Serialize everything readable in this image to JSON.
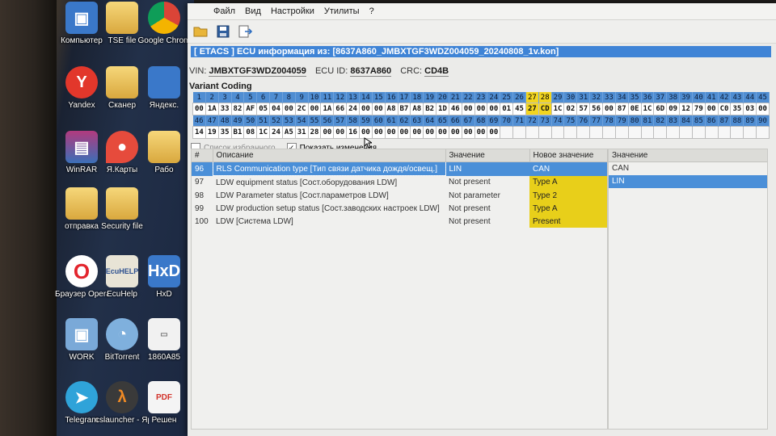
{
  "desktop": {
    "icons": [
      {
        "label": "Компьютер",
        "glyph": "▣",
        "cls": "g-comp",
        "name": "computer-icon"
      },
      {
        "label": "TSE file",
        "glyph": "",
        "cls": "folder",
        "name": "folder-icon"
      },
      {
        "label": "Google Chrom",
        "glyph": "",
        "cls": "g-chrome",
        "name": "chrome-icon"
      },
      {
        "label": "Yandex",
        "glyph": "Y",
        "cls": "g-yandex",
        "name": "yandex-icon"
      },
      {
        "label": "Сканер",
        "glyph": "",
        "cls": "folder",
        "name": "folder-icon"
      },
      {
        "label": "Яндекс.",
        "glyph": "",
        "cls": "g-comp",
        "name": "yandex-disk-icon"
      },
      {
        "label": "WinRAR",
        "glyph": "▤",
        "cls": "g-winrar",
        "name": "winrar-icon"
      },
      {
        "label": "Я.Карты",
        "glyph": "●",
        "cls": "g-maps",
        "name": "yandex-maps-icon"
      },
      {
        "label": "Рабо",
        "glyph": "",
        "cls": "folder",
        "name": "folder-icon"
      },
      {
        "label": "отправка",
        "glyph": "",
        "cls": "folder",
        "name": "folder-icon"
      },
      {
        "label": "Security file",
        "glyph": "",
        "cls": "folder",
        "name": "folder-icon"
      },
      {
        "label": "Браузер Opera",
        "glyph": "O",
        "cls": "g-opera",
        "name": "opera-icon"
      },
      {
        "label": "EcuHelp",
        "glyph": "EcuHELP",
        "cls": "g-ecu",
        "name": "ecuhelp-icon"
      },
      {
        "label": "HxD",
        "glyph": "HxD",
        "cls": "g-comp",
        "name": "hxd-icon"
      },
      {
        "label": "WORK",
        "glyph": "▣",
        "cls": "g-work",
        "name": "work-icon"
      },
      {
        "label": "BitTorrent",
        "glyph": "◔",
        "cls": "g-bt",
        "name": "bittorrent-icon"
      },
      {
        "label": "1860A85",
        "glyph": "▭",
        "cls": "g-doc",
        "name": "file-icon"
      },
      {
        "label": "Telegram",
        "glyph": "➤",
        "cls": "g-tg",
        "name": "telegram-icon"
      },
      {
        "label": "cslauncher - Ярлык",
        "glyph": "λ",
        "cls": "g-cs",
        "name": "cslauncher-icon"
      },
      {
        "label": "Решен",
        "glyph": "PDF",
        "cls": "g-pdf",
        "name": "pdf-icon"
      }
    ]
  },
  "menu": {
    "file": "Файл",
    "view": "Вид",
    "settings": "Настройки",
    "utilities": "Утилиты",
    "help": "?"
  },
  "toolbar": {
    "icons": [
      "folder-open-icon",
      "save-icon",
      "export-icon"
    ]
  },
  "header": {
    "title": "[ ETACS ] ECU информация из: [8637A860_JMBXTGF3WDZ004059_20240808_1v.kon]"
  },
  "info": {
    "vin_label": "VIN:",
    "vin": "JMBXTGF3WDZ004059",
    "ecu_label": "ECU ID:",
    "ecu": "8637A860",
    "crc_label": "CRC:",
    "crc": "CD4B"
  },
  "coding": {
    "label": "Variant Coding",
    "row1_idx": [
      "1",
      "2",
      "3",
      "4",
      "5",
      "6",
      "7",
      "8",
      "9",
      "10",
      "11",
      "12",
      "13",
      "14",
      "15",
      "16",
      "17",
      "18",
      "19",
      "20",
      "21",
      "22",
      "23",
      "24",
      "25",
      "26",
      "27",
      "28",
      "29",
      "30",
      "31",
      "32",
      "33",
      "34",
      "35",
      "36",
      "37",
      "38",
      "39",
      "40",
      "41",
      "42",
      "43",
      "44",
      "45"
    ],
    "row1_val": [
      "00",
      "1A",
      "33",
      "82",
      "AF",
      "05",
      "04",
      "00",
      "2C",
      "00",
      "1A",
      "66",
      "24",
      "00",
      "00",
      "A8",
      "B7",
      "A8",
      "B2",
      "1D",
      "46",
      "00",
      "00",
      "00",
      "01",
      "45",
      "27",
      "CD",
      "1C",
      "02",
      "57",
      "56",
      "00",
      "87",
      "0E",
      "1C",
      "6D",
      "09",
      "12",
      "79",
      "00",
      "C0",
      "35",
      "03",
      "00"
    ],
    "row2_idx": [
      "46",
      "47",
      "48",
      "49",
      "50",
      "51",
      "52",
      "53",
      "54",
      "55",
      "56",
      "57",
      "58",
      "59",
      "60",
      "61",
      "62",
      "63",
      "64",
      "65",
      "66",
      "67",
      "68",
      "69",
      "70",
      "71",
      "72",
      "73",
      "74",
      "75",
      "76",
      "77",
      "78",
      "79",
      "80",
      "81",
      "82",
      "83",
      "84",
      "85",
      "86",
      "87",
      "88",
      "89",
      "90"
    ],
    "row2_val": [
      "14",
      "19",
      "35",
      "B1",
      "08",
      "1C",
      "24",
      "A5",
      "31",
      "28",
      "00",
      "00",
      "16",
      "00",
      "00",
      "00",
      "00",
      "00",
      "00",
      "00",
      "00",
      "00",
      "00",
      "00",
      "",
      "",
      "",
      "",
      "",
      "",
      "",
      "",
      "",
      "",
      "",
      "",
      "",
      "",
      "",
      "",
      "",
      "",
      "",
      "",
      ""
    ],
    "highlight_indices": [
      26,
      27
    ]
  },
  "filters": {
    "favorites": "Список избранного",
    "favorites_checked": false,
    "show_changes": "Показать изменения",
    "show_changes_checked": true
  },
  "params": {
    "columns": {
      "num": "#",
      "desc": "Описание",
      "value": "Значение",
      "new_value": "Новое значение"
    },
    "rows": [
      {
        "num": "96",
        "desc": "RLS Communication type  [Тип связи датчика дождя/освещ.]",
        "value": "LIN",
        "new_value": "CAN",
        "selected": true
      },
      {
        "num": "97",
        "desc": "LDW equipment status  [Сост.оборудования LDW]",
        "value": "Not present",
        "new_value": "Type A",
        "selected": false
      },
      {
        "num": "98",
        "desc": "LDW Parameter status  [Сост.параметров LDW]",
        "value": "Not parameter",
        "new_value": "Type 2",
        "selected": false
      },
      {
        "num": "99",
        "desc": "LDW production setup status  [Сост.заводских настроек LDW]",
        "value": "Not present",
        "new_value": "Type A",
        "selected": false
      },
      {
        "num": "100",
        "desc": "LDW  [Система LDW]",
        "value": "Not present",
        "new_value": "Present",
        "selected": false
      }
    ]
  },
  "options": {
    "header": "Значение",
    "items": [
      {
        "label": "CAN",
        "selected": false
      },
      {
        "label": "LIN",
        "selected": true
      }
    ]
  },
  "colors": {
    "title_blue": "#3f84d6",
    "selection_blue": "#4a8fd8",
    "changed_yellow": "#e8cf1a"
  }
}
